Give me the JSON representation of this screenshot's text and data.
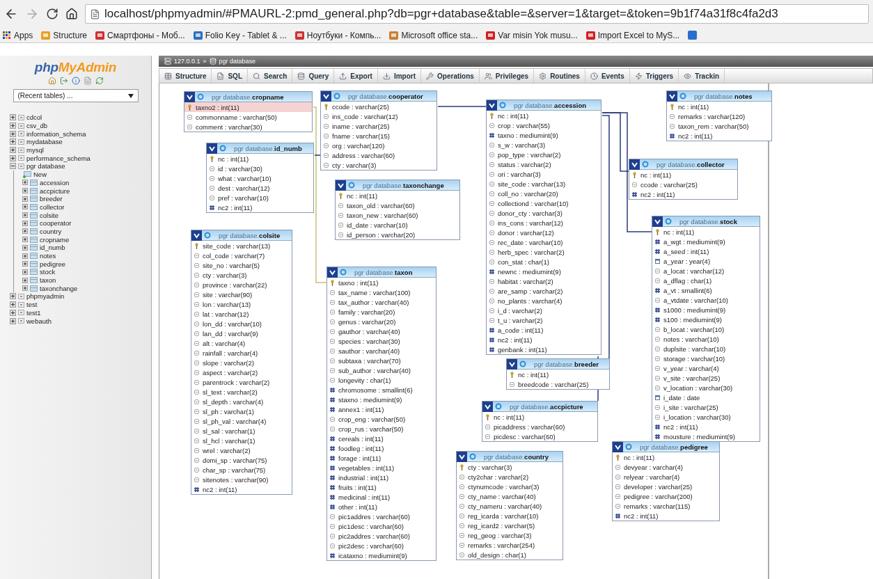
{
  "browser": {
    "url": "localhost/phpmyadmin/#PMAURL-2:pmd_general.php?db=pgr+database&table=&server=1&target=&token=9b1f74a31f8c4fa2d3",
    "bookmarks": [
      "Apps",
      "Structure",
      "Смартфоны - Моб...",
      "Folio Key - Tablet & ...",
      "Ноутбуки - Компь...",
      "Microsoft office sta...",
      "Var misin Yok musu...",
      "Import Excel to MyS..."
    ]
  },
  "sidebar": {
    "logo_parts": [
      "php",
      "MyAdmin"
    ],
    "recent_tables": "(Recent tables) ...",
    "databases": [
      {
        "label": "cdcol",
        "expanded": false
      },
      {
        "label": "csv_db",
        "expanded": false
      },
      {
        "label": "information_schema",
        "expanded": false
      },
      {
        "label": "mydatabase",
        "expanded": false
      },
      {
        "label": "mysql",
        "expanded": false
      },
      {
        "label": "performance_schema",
        "expanded": false
      },
      {
        "label": "pgr database",
        "expanded": true,
        "children": [
          {
            "label": "New",
            "kind": "new"
          },
          {
            "label": "accession",
            "kind": "table"
          },
          {
            "label": "accpicture",
            "kind": "table"
          },
          {
            "label": "breeder",
            "kind": "table"
          },
          {
            "label": "collector",
            "kind": "table"
          },
          {
            "label": "colsite",
            "kind": "table"
          },
          {
            "label": "cooperator",
            "kind": "table"
          },
          {
            "label": "country",
            "kind": "table"
          },
          {
            "label": "cropname",
            "kind": "table"
          },
          {
            "label": "id_numb",
            "kind": "table"
          },
          {
            "label": "notes",
            "kind": "table"
          },
          {
            "label": "pedigree",
            "kind": "table"
          },
          {
            "label": "stock",
            "kind": "table"
          },
          {
            "label": "taxon",
            "kind": "table"
          },
          {
            "label": "taxonchange",
            "kind": "table"
          }
        ]
      },
      {
        "label": "phpmyadmin",
        "expanded": false
      },
      {
        "label": "test",
        "expanded": false
      },
      {
        "label": "test1",
        "expanded": false
      },
      {
        "label": "webauth",
        "expanded": false
      }
    ]
  },
  "breadcrumb": {
    "server": "127.0.0.1",
    "separator": "»",
    "database": "pgr database"
  },
  "tabs": [
    "Structure",
    "SQL",
    "Search",
    "Query",
    "Export",
    "Import",
    "Operations",
    "Privileges",
    "Routines",
    "Events",
    "Triggers",
    "Trackin"
  ],
  "tables": [
    {
      "title": "pgr database.**cropname**",
      "fields": [
        {
          "kind": "key",
          "text": "taxno2 : int(11)",
          "highlighted": true
        },
        {
          "kind": "text",
          "text": "commonname : varchar(50)",
          "highlighted": false
        },
        {
          "kind": "text",
          "text": "comment : varchar(30)",
          "highlighted": false
        }
      ]
    },
    {
      "title": "pgr database.**cooperator**",
      "fields": [
        {
          "kind": "key",
          "text": "ccode : varchar(25)"
        },
        {
          "kind": "text",
          "text": "ins_code : varchar(12)"
        },
        {
          "kind": "text",
          "text": "iname : varchar(25)"
        },
        {
          "kind": "text",
          "text": "fname : varchar(15)"
        },
        {
          "kind": "text",
          "text": "org : varchar(120)"
        },
        {
          "kind": "text",
          "text": "address : varchar(60)"
        },
        {
          "kind": "text",
          "text": "cty : varchar(3)"
        }
      ]
    },
    {
      "title": "pgr database.**accession**",
      "fields": [
        {
          "kind": "key",
          "text": "nc : int(11)"
        },
        {
          "kind": "text",
          "text": "crop : varchar(55)"
        },
        {
          "kind": "number",
          "text": "taxno : mediumint(9)"
        },
        {
          "kind": "text",
          "text": "s_w : varchar(3)"
        },
        {
          "kind": "text",
          "text": "pop_type : varchar(2)"
        },
        {
          "kind": "text",
          "text": "status : varchar(2)"
        },
        {
          "kind": "text",
          "text": "ori : varchar(3)"
        },
        {
          "kind": "text",
          "text": "site_code : varchar(13)"
        },
        {
          "kind": "text",
          "text": "coll_no : varchar(20)"
        },
        {
          "kind": "text",
          "text": "collectiond : varchar(10)"
        },
        {
          "kind": "text",
          "text": "donor_cty : varchar(3)"
        },
        {
          "kind": "text",
          "text": "ins_cons : varchar(12)"
        },
        {
          "kind": "text",
          "text": "donor : varchar(12)"
        },
        {
          "kind": "text",
          "text": "rec_date : varchar(10)"
        },
        {
          "kind": "text",
          "text": "herb_spec : varchar(2)"
        },
        {
          "kind": "text",
          "text": "con_stat : char(1)"
        },
        {
          "kind": "number",
          "text": "newnc : mediumint(9)"
        },
        {
          "kind": "text",
          "text": "habitat : varchar(2)"
        },
        {
          "kind": "text",
          "text": "are_samp : varchar(2)"
        },
        {
          "kind": "text",
          "text": "no_plants : varchar(4)"
        },
        {
          "kind": "text",
          "text": "i_d : varchar(2)"
        },
        {
          "kind": "text",
          "text": "t_u : varchar(2)"
        },
        {
          "kind": "number",
          "text": "a_code : int(11)"
        },
        {
          "kind": "number",
          "text": "nc2 : int(11)"
        },
        {
          "kind": "number",
          "text": "genbank : int(11)"
        }
      ]
    },
    {
      "title": "pgr database.**notes**",
      "fields": [
        {
          "kind": "key",
          "text": "nc : int(11)"
        },
        {
          "kind": "text",
          "text": "remarks : varchar(120)"
        },
        {
          "kind": "text",
          "text": "taxon_rem : varchar(50)"
        },
        {
          "kind": "number",
          "text": "nc2 : int(11)"
        }
      ]
    },
    {
      "title": "pgr database.**id_numb**",
      "fields": [
        {
          "kind": "key",
          "text": "nc : int(11)"
        },
        {
          "kind": "text",
          "text": "id : varchar(30)"
        },
        {
          "kind": "text",
          "text": "what : varchar(10)"
        },
        {
          "kind": "text",
          "text": "dest : varchar(12)"
        },
        {
          "kind": "text",
          "text": "pref : varchar(10)"
        },
        {
          "kind": "number",
          "text": "nc2 : int(11)"
        }
      ]
    },
    {
      "title": "pgr database.**collector**",
      "fields": [
        {
          "kind": "key",
          "text": "nc : int(11)"
        },
        {
          "kind": "text",
          "text": "ccode : varchar(25)"
        },
        {
          "kind": "number",
          "text": "nc2 : int(11)"
        }
      ]
    },
    {
      "title": "pgr database.**taxonchange**",
      "fields": [
        {
          "kind": "key",
          "text": "nc : int(11)"
        },
        {
          "kind": "text",
          "text": "taxon_old : varchar(60)"
        },
        {
          "kind": "text",
          "text": "taxon_new : varchar(60)"
        },
        {
          "kind": "text",
          "text": "id_date : varchar(10)"
        },
        {
          "kind": "text",
          "text": "id_person : varchar(20)"
        }
      ]
    },
    {
      "title": "pgr database.**stock**",
      "fields": [
        {
          "kind": "key",
          "text": "nc : int(11)"
        },
        {
          "kind": "number",
          "text": "a_wgt : mediumint(9)"
        },
        {
          "kind": "number",
          "text": "a_seed : int(11)"
        },
        {
          "kind": "date",
          "text": "a_year : year(4)"
        },
        {
          "kind": "text",
          "text": "a_locat : varchar(12)"
        },
        {
          "kind": "text",
          "text": "a_dflag : char(1)"
        },
        {
          "kind": "number",
          "text": "a_vt : smallint(6)"
        },
        {
          "kind": "text",
          "text": "a_vtdate : varchar(10)"
        },
        {
          "kind": "number",
          "text": "s1000 : mediumint(9)"
        },
        {
          "kind": "number",
          "text": "s100 : mediumint(9)"
        },
        {
          "kind": "text",
          "text": "b_locat : varchar(10)"
        },
        {
          "kind": "text",
          "text": "notes : varchar(10)"
        },
        {
          "kind": "text",
          "text": "duplsite : varchar(10)"
        },
        {
          "kind": "text",
          "text": "storage : varchar(10)"
        },
        {
          "kind": "text",
          "text": "v_year : varchar(4)"
        },
        {
          "kind": "text",
          "text": "v_site : varchar(25)"
        },
        {
          "kind": "text",
          "text": "v_location : varchar(30)"
        },
        {
          "kind": "date",
          "text": "i_date : date"
        },
        {
          "kind": "text",
          "text": "i_site : varchar(25)"
        },
        {
          "kind": "text",
          "text": "i_location : varchar(30)"
        },
        {
          "kind": "number",
          "text": "nc2 : int(11)"
        },
        {
          "kind": "number",
          "text": "mousture : mediumint(9)"
        }
      ]
    },
    {
      "title": "pgr database.**colsite**",
      "fields": [
        {
          "kind": "key",
          "text": "site_code : varchar(13)"
        },
        {
          "kind": "text",
          "text": "col_code : varchar(7)"
        },
        {
          "kind": "text",
          "text": "site_no : varchar(5)"
        },
        {
          "kind": "text",
          "text": "cty : varchar(3)"
        },
        {
          "kind": "text",
          "text": "province : varchar(22)"
        },
        {
          "kind": "text",
          "text": "site : varchar(90)"
        },
        {
          "kind": "text",
          "text": "lon : varchar(13)"
        },
        {
          "kind": "text",
          "text": "lat : varchar(12)"
        },
        {
          "kind": "text",
          "text": "lon_dd : varchar(10)"
        },
        {
          "kind": "text",
          "text": "lan_dd : varchar(9)"
        },
        {
          "kind": "text",
          "text": "alt : varchar(4)"
        },
        {
          "kind": "text",
          "text": "rainfall : varchar(4)"
        },
        {
          "kind": "text",
          "text": "slope : varchar(2)"
        },
        {
          "kind": "text",
          "text": "aspect : varchar(2)"
        },
        {
          "kind": "text",
          "text": "parentrock : varchar(2)"
        },
        {
          "kind": "text",
          "text": "sl_text : varchar(2)"
        },
        {
          "kind": "text",
          "text": "sl_depth : varchar(4)"
        },
        {
          "kind": "text",
          "text": "sl_ph : varchar(1)"
        },
        {
          "kind": "text",
          "text": "sl_ph_val : varchar(4)"
        },
        {
          "kind": "text",
          "text": "sl_sal : varchar(1)"
        },
        {
          "kind": "text",
          "text": "sl_hcl : varchar(1)"
        },
        {
          "kind": "text",
          "text": "wrel : varchar(2)"
        },
        {
          "kind": "text",
          "text": "domi_sp : varchar(75)"
        },
        {
          "kind": "text",
          "text": "char_sp : varchar(75)"
        },
        {
          "kind": "text",
          "text": "sitenotes : varchar(90)"
        },
        {
          "kind": "number",
          "text": "nc2 : int(11)"
        }
      ]
    },
    {
      "title": "pgr database.**taxon**",
      "fields": [
        {
          "kind": "key",
          "text": "taxno : int(11)"
        },
        {
          "kind": "text",
          "text": "tax_name : varchar(100)"
        },
        {
          "kind": "text",
          "text": "tax_author : varchar(40)"
        },
        {
          "kind": "text",
          "text": "family : varchar(20)"
        },
        {
          "kind": "text",
          "text": "genus : varchar(20)"
        },
        {
          "kind": "text",
          "text": "gauthor : varchar(40)"
        },
        {
          "kind": "text",
          "text": "species : varchar(30)"
        },
        {
          "kind": "text",
          "text": "sauthor : varchar(40)"
        },
        {
          "kind": "text",
          "text": "subtaxa : varchar(70)"
        },
        {
          "kind": "text",
          "text": "sub_author : varchar(40)"
        },
        {
          "kind": "text",
          "text": "longevity : char(1)"
        },
        {
          "kind": "number",
          "text": "chromosome : smallint(6)"
        },
        {
          "kind": "number",
          "text": "staxno : mediumint(9)"
        },
        {
          "kind": "number",
          "text": "annex1 : int(11)"
        },
        {
          "kind": "text",
          "text": "crop_eng : varchar(50)"
        },
        {
          "kind": "text",
          "text": "crop_rus : varchar(50)"
        },
        {
          "kind": "number",
          "text": "cereals : int(11)"
        },
        {
          "kind": "number",
          "text": "foodleg : int(11)"
        },
        {
          "kind": "number",
          "text": "forage : int(11)"
        },
        {
          "kind": "number",
          "text": "vegetables : int(11)"
        },
        {
          "kind": "number",
          "text": "industrial : int(11)"
        },
        {
          "kind": "number",
          "text": "fruits : int(11)"
        },
        {
          "kind": "number",
          "text": "medicinal : int(11)"
        },
        {
          "kind": "number",
          "text": "other : int(11)"
        },
        {
          "kind": "text",
          "text": "pic1addres : varchar(60)"
        },
        {
          "kind": "text",
          "text": "pic1desc : varchar(60)"
        },
        {
          "kind": "text",
          "text": "pic2addres : varchar(60)"
        },
        {
          "kind": "text",
          "text": "pic2desc : varchar(60)"
        },
        {
          "kind": "number",
          "text": "icataxno : mediumint(9)"
        }
      ]
    },
    {
      "title": "pgr database.**breeder**",
      "fields": [
        {
          "kind": "key",
          "text": "nc : int(11)"
        },
        {
          "kind": "text",
          "text": "breedcode : varchar(25)"
        }
      ]
    },
    {
      "title": "pgr database.**accpicture**",
      "fields": [
        {
          "kind": "key",
          "text": "nc : int(11)"
        },
        {
          "kind": "text",
          "text": "picaddress : varchar(60)"
        },
        {
          "kind": "text",
          "text": "picdesc : varchar(60)"
        }
      ]
    },
    {
      "title": "pgr database.**pedigree**",
      "fields": [
        {
          "kind": "key",
          "text": "nc : int(11)"
        },
        {
          "kind": "text",
          "text": "devyear : varchar(4)"
        },
        {
          "kind": "text",
          "text": "relyear : varchar(4)"
        },
        {
          "kind": "text",
          "text": "developer : varchar(25)"
        },
        {
          "kind": "text",
          "text": "pedigree : varchar(200)"
        },
        {
          "kind": "text",
          "text": "remarks : varchar(115)"
        },
        {
          "kind": "number",
          "text": "nc2 : int(11)"
        }
      ]
    },
    {
      "title": "pgr database.**country**",
      "fields": [
        {
          "kind": "key",
          "text": "cty : varchar(3)"
        },
        {
          "kind": "text",
          "text": "cty2char : varchar(2)"
        },
        {
          "kind": "text",
          "text": "ctynumcode : varchar(3)"
        },
        {
          "kind": "text",
          "text": "cty_name : varchar(40)"
        },
        {
          "kind": "text",
          "text": "cty_nameru : varchar(40)"
        },
        {
          "kind": "text",
          "text": "reg_icarda : varchar(10)"
        },
        {
          "kind": "text",
          "text": "reg_icard2 : varchar(5)"
        },
        {
          "kind": "text",
          "text": "reg_geog : varchar(3)"
        },
        {
          "kind": "text",
          "text": "remarks : varchar(254)"
        },
        {
          "kind": "text",
          "text": "old_design : char(1)"
        }
      ]
    }
  ]
}
